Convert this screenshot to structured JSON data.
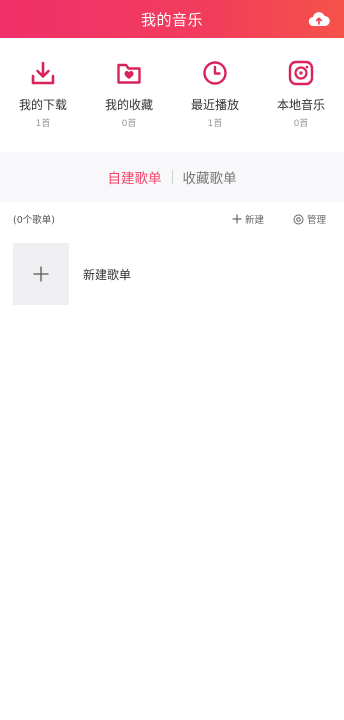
{
  "header": {
    "title": "我的音乐",
    "upload_icon": "cloud-upload-icon"
  },
  "colors": {
    "header_gradient_start": "#f0306a",
    "header_gradient_end": "#f5524a",
    "accent": "#d9235a",
    "active_tab": "#f0466a"
  },
  "quick_access": [
    {
      "label": "我的下载",
      "count": "1首",
      "icon": "download-icon"
    },
    {
      "label": "我的收藏",
      "count": "0首",
      "icon": "favorites-folder-icon"
    },
    {
      "label": "最近播放",
      "count": "1首",
      "icon": "clock-icon"
    },
    {
      "label": "本地音乐",
      "count": "0首",
      "icon": "vinyl-record-icon"
    }
  ],
  "tabs": [
    {
      "label": "自建歌单",
      "active": true
    },
    {
      "label": "收藏歌单",
      "active": false
    }
  ],
  "toolbar": {
    "playlist_count": "(0个歌单)",
    "new_label": "新建",
    "manage_label": "管理"
  },
  "new_playlist": {
    "label": "新建歌单"
  }
}
